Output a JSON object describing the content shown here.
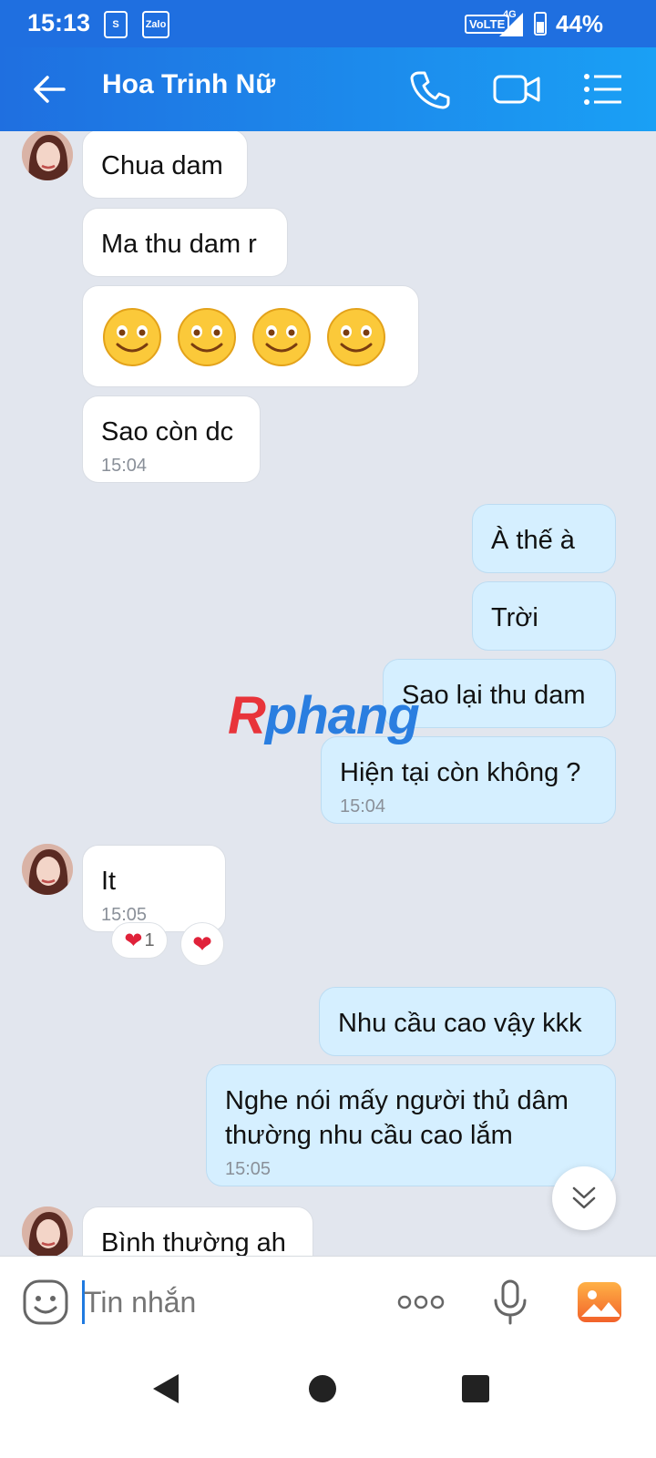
{
  "status_bar": {
    "time": "15:13",
    "network": "4G",
    "volte": "VoLTE",
    "battery": "44%",
    "app_icons": [
      "shopee-icon",
      "zalo-icon"
    ],
    "zalo_label": "Zalo"
  },
  "header": {
    "contact_name": "Hoa Trinh Nữ"
  },
  "messages": [
    {
      "side": "in",
      "text": "Chua dam"
    },
    {
      "side": "in",
      "text": "Ma thu dam r"
    },
    {
      "side": "in",
      "type": "emoji",
      "emoji": "smile",
      "count": 4
    },
    {
      "side": "in",
      "text": "Sao còn dc",
      "time": "15:04"
    },
    {
      "side": "out",
      "text": "À thế à"
    },
    {
      "side": "out",
      "text": "Trời"
    },
    {
      "side": "out",
      "text": "Sao lại thu dam"
    },
    {
      "side": "out",
      "text": "Hiện tại còn không ?",
      "time": "15:04"
    },
    {
      "side": "in",
      "text": "It",
      "time": "15:05",
      "reaction": {
        "emoji": "heart",
        "count": "1"
      }
    },
    {
      "side": "out",
      "text": "Nhu cầu cao vậy kkk"
    },
    {
      "side": "out",
      "text": "Nghe nói mấy người thủ dâm thường nhu cầu cao lắm",
      "time": "15:05"
    },
    {
      "side": "in",
      "text": "Bình thường ah"
    }
  ],
  "watermark": {
    "first": "R",
    "rest": "phang"
  },
  "input": {
    "placeholder": "Tin nhắn"
  },
  "colors": {
    "header": "#1f6fe0",
    "incoming": "#ffffff",
    "outgoing": "#d5efff",
    "background": "#e2e6ee"
  }
}
